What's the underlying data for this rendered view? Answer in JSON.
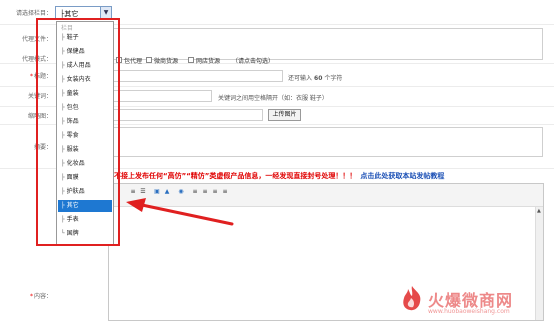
{
  "form": {
    "column_label": "请选择栏目：",
    "selected_column": "├其它",
    "agent_file_label": "代理文件：",
    "agent_method_label": "代理模式：",
    "agent_method_opt1": "包代理",
    "agent_method_opt2": "微商货源",
    "agent_method_opt3": "网店货源",
    "agent_method_hint": "（请点击勾选）",
    "title_label": "标题：",
    "title_hint_prefix": "还可输入",
    "title_hint_count": "60",
    "title_hint_suffix": "个字符",
    "keywords_label": "关键词：",
    "keywords_hint": "关键词之间用空格隔开（如：衣服 鞋子）",
    "thumbnail_label": "缩略图：",
    "upload_button": "上传图片",
    "summary_label": "摘要：",
    "content_label": "内容：",
    "warning_text": "不接上发布任何“高仿”“精仿”类虚假产品信息，一经发现直接封号处理！！！",
    "tutorial_link": "点击此处获取本站发帖教程"
  },
  "dropdown": {
    "header": "栏目",
    "items": [
      {
        "prefix": "├",
        "label": "鞋子"
      },
      {
        "prefix": "├",
        "label": "保健品"
      },
      {
        "prefix": "├",
        "label": "成人用品"
      },
      {
        "prefix": "├",
        "label": "女装内衣"
      },
      {
        "prefix": "├",
        "label": "童装"
      },
      {
        "prefix": "├",
        "label": "包包"
      },
      {
        "prefix": "├",
        "label": "饰品"
      },
      {
        "prefix": "├",
        "label": "零食"
      },
      {
        "prefix": "├",
        "label": "服装"
      },
      {
        "prefix": "├",
        "label": "化妆品"
      },
      {
        "prefix": "├",
        "label": "面膜"
      },
      {
        "prefix": "├",
        "label": "护肤品"
      },
      {
        "prefix": "├",
        "label": "其它"
      },
      {
        "prefix": "├",
        "label": "手表"
      },
      {
        "prefix": "└",
        "label": "国牌"
      }
    ],
    "selected_index": 12
  },
  "watermark": {
    "brand": "火爆微商网",
    "url": "www.huobaoweishang.com"
  },
  "colors": {
    "highlight_border": "#e02020",
    "arrow": "#e02020",
    "selected_bg": "#1e78d2",
    "warning": "#e00000",
    "link": "#1a4fb5"
  }
}
